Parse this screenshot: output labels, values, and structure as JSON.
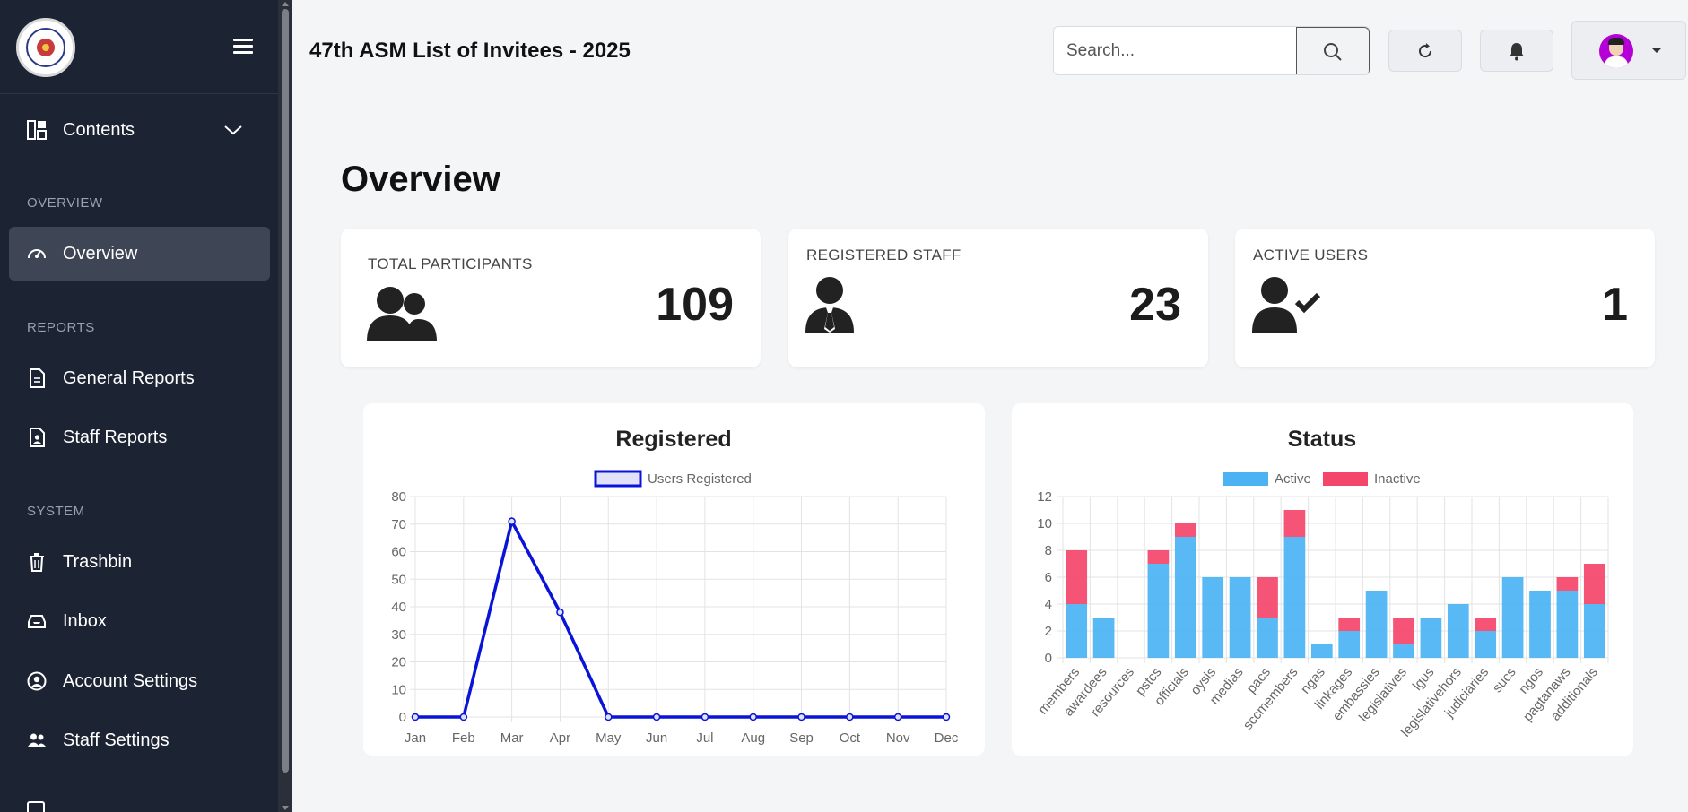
{
  "app": {
    "title": "47th ASM List of Invitees - 2025"
  },
  "sidebar": {
    "top_item": {
      "label": "Contents",
      "icon": "dashboard-grid-icon"
    },
    "sections": [
      {
        "label": "OVERVIEW",
        "items": [
          {
            "label": "Overview",
            "icon": "speedometer-icon",
            "active": true
          }
        ]
      },
      {
        "label": "REPORTS",
        "items": [
          {
            "label": "General Reports",
            "icon": "document-icon"
          },
          {
            "label": "Staff Reports",
            "icon": "document-person-icon"
          }
        ]
      },
      {
        "label": "SYSTEM",
        "items": [
          {
            "label": "Trashbin",
            "icon": "trash-icon"
          },
          {
            "label": "Inbox",
            "icon": "inbox-icon"
          },
          {
            "label": "Account Settings",
            "icon": "user-circle-icon"
          },
          {
            "label": "Staff Settings",
            "icon": "users-icon"
          }
        ]
      }
    ]
  },
  "header": {
    "search_placeholder": "Search..."
  },
  "main": {
    "heading": "Overview",
    "stats": [
      {
        "label": "TOTAL PARTICIPANTS",
        "value": "109",
        "icon": "users-group-icon"
      },
      {
        "label": "REGISTERED STAFF",
        "value": "23",
        "icon": "user-tie-icon"
      },
      {
        "label": "ACTIVE USERS",
        "value": "1",
        "icon": "user-check-icon"
      }
    ]
  },
  "chart_data": [
    {
      "type": "line",
      "title": "Registered",
      "categories": [
        "Jan",
        "Feb",
        "Mar",
        "Apr",
        "May",
        "Jun",
        "Jul",
        "Aug",
        "Sep",
        "Oct",
        "Nov",
        "Dec"
      ],
      "series": [
        {
          "name": "Users Registered",
          "values": [
            0,
            0,
            71,
            38,
            0,
            0,
            0,
            0,
            0,
            0,
            0,
            0
          ],
          "color": "#0a14d9"
        }
      ],
      "ylim": [
        0,
        80
      ],
      "yticks": [
        0,
        10,
        20,
        30,
        40,
        50,
        60,
        70,
        80
      ],
      "grid": true,
      "legend": "top-center"
    },
    {
      "type": "bar",
      "stacked": true,
      "title": "Status",
      "categories": [
        "members",
        "awardees",
        "resources",
        "pstcs",
        "officials",
        "oysis",
        "medias",
        "pacs",
        "sccmembers",
        "ngas",
        "linkages",
        "embassies",
        "legislatives",
        "lgus",
        "legislativehors",
        "judiciaries",
        "sucs",
        "ngos",
        "pagtanaws",
        "additionals"
      ],
      "series": [
        {
          "name": "Active",
          "values": [
            4,
            3,
            0,
            7,
            9,
            6,
            6,
            3,
            9,
            1,
            2,
            5,
            1,
            3,
            4,
            2,
            6,
            5,
            5,
            4
          ],
          "color": "#4bb3f3"
        },
        {
          "name": "Inactive",
          "values": [
            4,
            0,
            0,
            1,
            1,
            0,
            0,
            3,
            2,
            0,
            1,
            0,
            2,
            0,
            0,
            1,
            0,
            0,
            1,
            3
          ],
          "color": "#f4456b"
        }
      ],
      "ylim": [
        0,
        12
      ],
      "yticks": [
        0,
        2,
        4,
        6,
        8,
        10,
        12
      ],
      "grid": true,
      "legend": "top-center"
    }
  ]
}
